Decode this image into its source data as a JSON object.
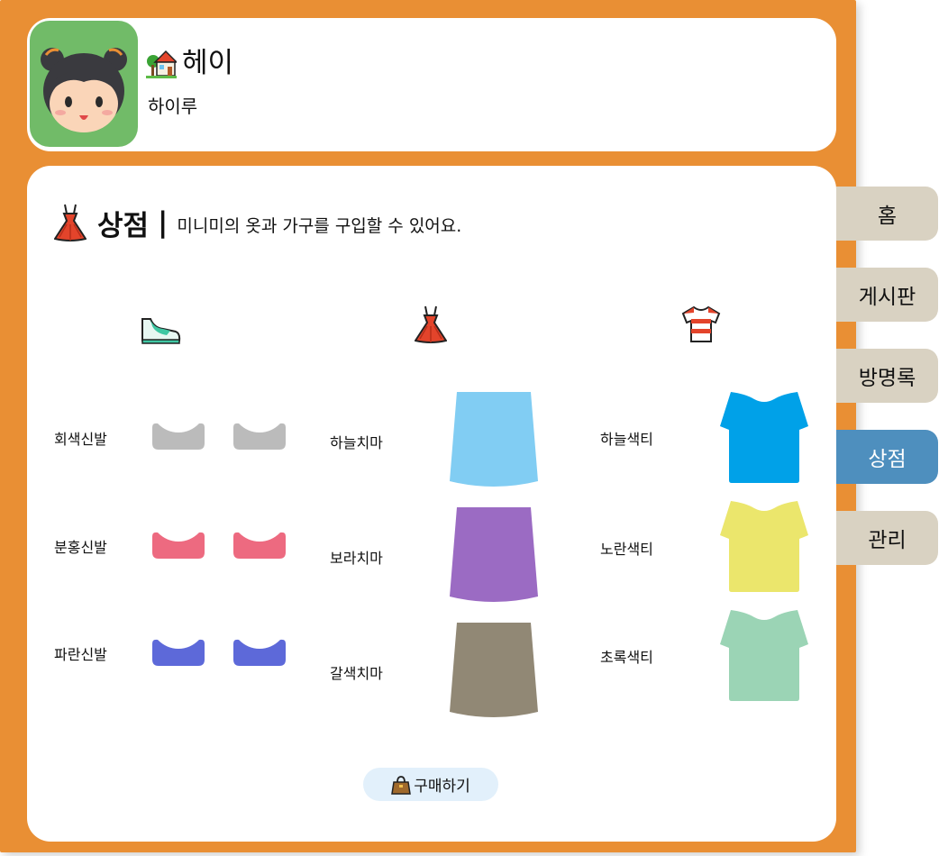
{
  "header": {
    "name": "헤이",
    "subtitle": "하이루",
    "house_icon": "house-with-garden-icon",
    "avatar": "girl-avatar"
  },
  "shop": {
    "title": "상점",
    "separator": "|",
    "description": "미니미의 옷과 가구를 구입할 수 있어요.",
    "title_icon": "dress-icon"
  },
  "columns": [
    {
      "icon": "sneaker-icon",
      "items": [
        {
          "label": "회색신발",
          "color": "#bbbbbb"
        },
        {
          "label": "분홍신발",
          "color": "#ed6a80"
        },
        {
          "label": "파란신발",
          "color": "#5d69d9"
        }
      ]
    },
    {
      "icon": "dress-icon",
      "items": [
        {
          "label": "하늘치마",
          "color": "#81cdf3"
        },
        {
          "label": "보라치마",
          "color": "#9b6bc3"
        },
        {
          "label": "갈색치마",
          "color": "#918875"
        }
      ]
    },
    {
      "icon": "tshirt-icon",
      "items": [
        {
          "label": "하늘색티",
          "color": "#00a1e8"
        },
        {
          "label": "노란색티",
          "color": "#ebe66c"
        },
        {
          "label": "초록색티",
          "color": "#9bd4b5"
        }
      ]
    }
  ],
  "buy_button": {
    "label": "구매하기",
    "icon": "handbag-icon"
  },
  "nav": [
    {
      "label": "홈",
      "active": false
    },
    {
      "label": "게시판",
      "active": false
    },
    {
      "label": "방명록",
      "active": false
    },
    {
      "label": "상점",
      "active": true
    },
    {
      "label": "관리",
      "active": false
    }
  ],
  "colors": {
    "frame": "#e98f34",
    "tab": "#d9d2c2",
    "tab_active": "#4e8fbe",
    "avatar_bg": "#71bb68",
    "buy_bg": "#e2f0fb"
  }
}
